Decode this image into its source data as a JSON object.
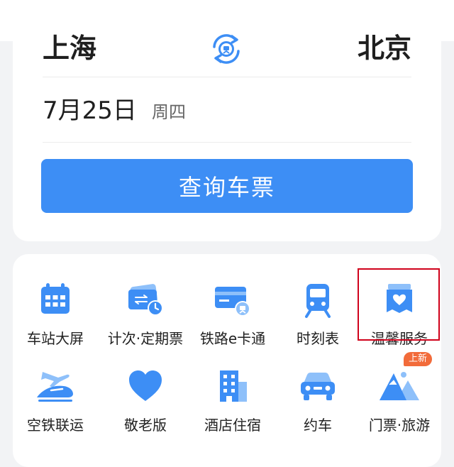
{
  "route": {
    "from_city": "上海",
    "to_city": "北京",
    "date": "7月25日",
    "weekday": "周四",
    "query_label": "查询车票"
  },
  "menu": {
    "row1": [
      {
        "label": "车站大屏",
        "icon": "calendar-icon"
      },
      {
        "label": "计次·定期票",
        "icon": "ticket-clock-icon"
      },
      {
        "label": "铁路e卡通",
        "icon": "railway-card-icon"
      },
      {
        "label": "时刻表",
        "icon": "train-icon"
      },
      {
        "label": "温馨服务",
        "icon": "heart-service-icon",
        "highlighted": true
      }
    ],
    "row2": [
      {
        "label": "空铁联运",
        "icon": "plane-train-icon"
      },
      {
        "label": "敬老版",
        "icon": "heart-icon"
      },
      {
        "label": "酒店住宿",
        "icon": "hotel-building-icon"
      },
      {
        "label": "约车",
        "icon": "car-icon"
      },
      {
        "label": "门票·旅游",
        "icon": "mountain-icon",
        "badge": "上新"
      }
    ]
  },
  "colors": {
    "accent": "#3d8ef5",
    "icon_light": "#8ec0fa",
    "badge": "#f26b3a",
    "highlight": "#d0021b"
  }
}
